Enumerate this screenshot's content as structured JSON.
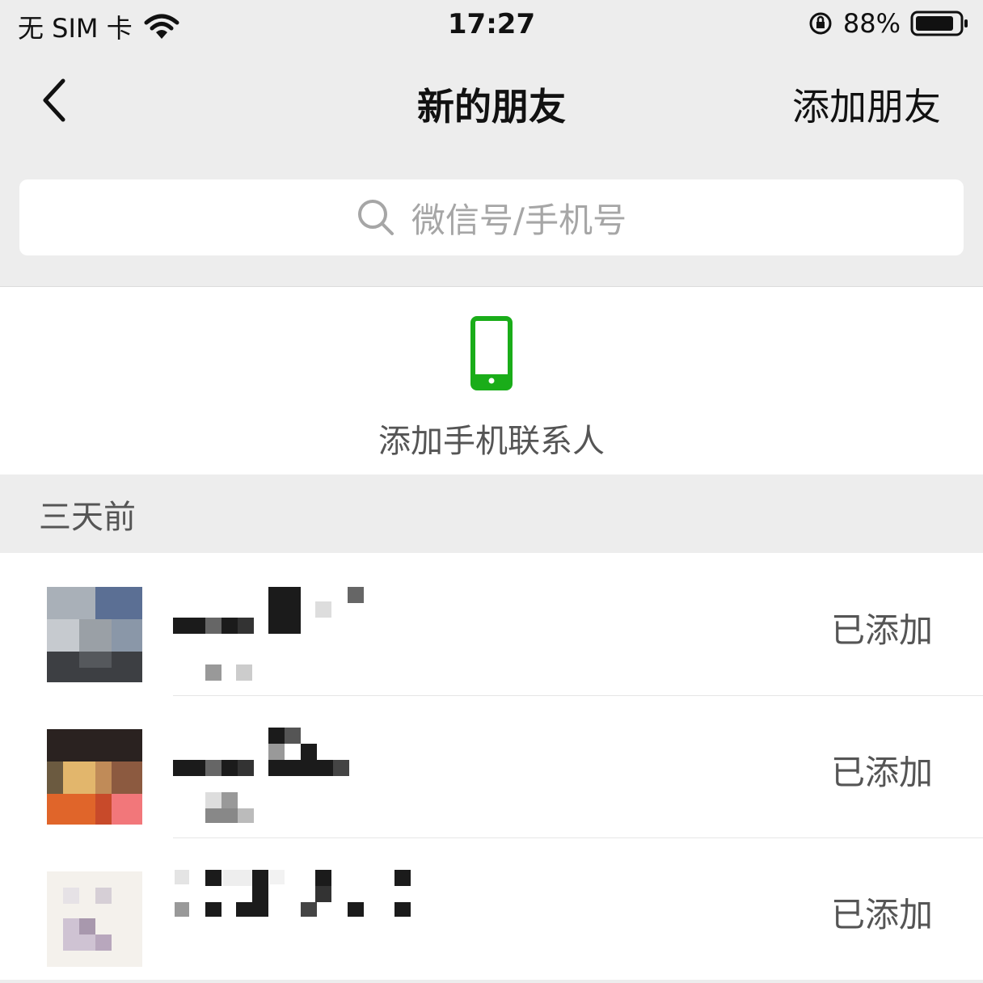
{
  "status_bar": {
    "carrier": "无 SIM 卡",
    "time": "17:27",
    "battery_percent": "88%",
    "wifi_icon": "wifi-icon",
    "battery_level": 0.88
  },
  "nav": {
    "title": "新的朋友",
    "action_label": "添加朋友"
  },
  "search": {
    "placeholder": "微信号/手机号"
  },
  "phone_contacts": {
    "label": "添加手机联系人",
    "icon": "mobile-phone-icon",
    "icon_color": "#1aad19"
  },
  "section": {
    "label": "三天前"
  },
  "requests": [
    {
      "status": "已添加"
    },
    {
      "status": "已添加"
    },
    {
      "status": "已添加"
    }
  ]
}
